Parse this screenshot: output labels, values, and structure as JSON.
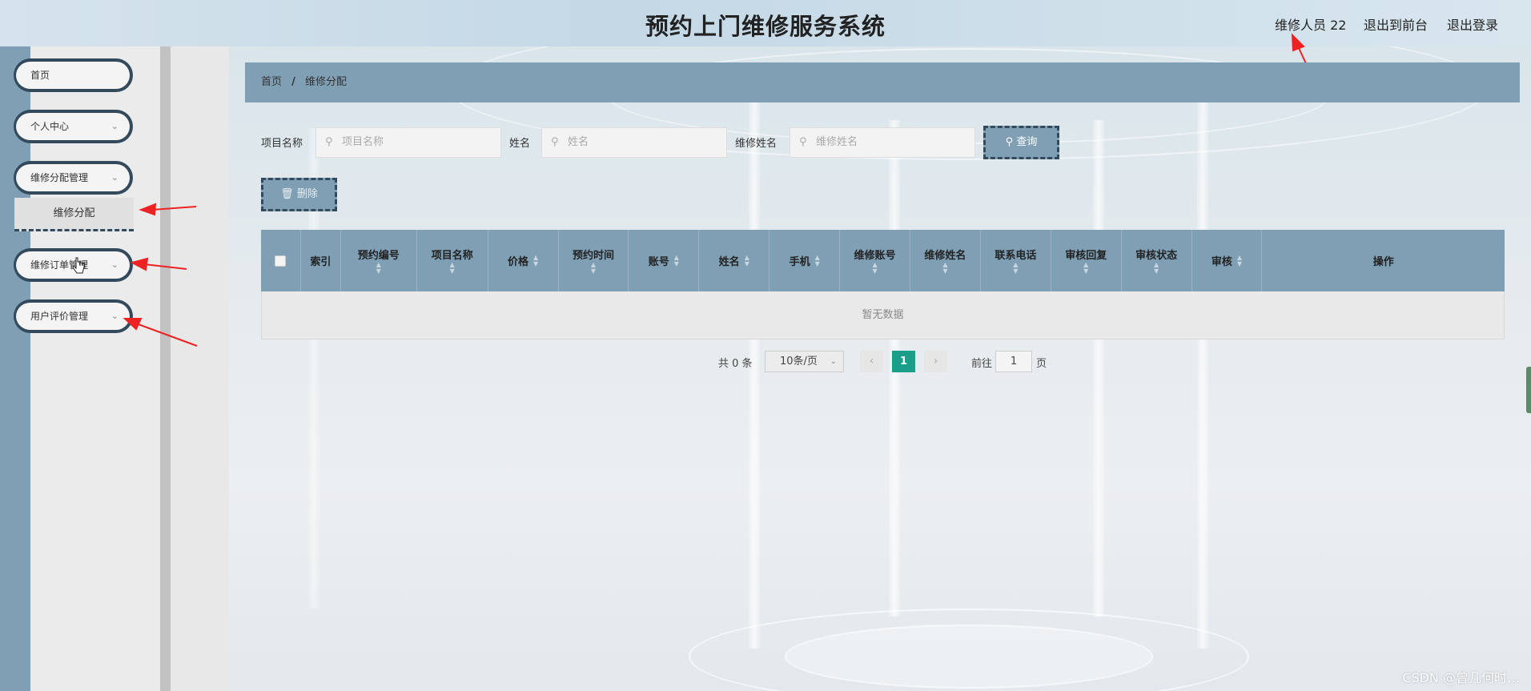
{
  "header": {
    "title": "预约上门维修服务系统",
    "user_label": "维修人员 22",
    "front_link": "退出到前台",
    "logout_link": "退出登录"
  },
  "sidebar": {
    "items": [
      {
        "label": "首页"
      },
      {
        "label": "个人中心"
      },
      {
        "label": "维修分配管理"
      },
      {
        "label": "维修订单管理"
      },
      {
        "label": "用户评价管理"
      }
    ],
    "active_sub": "维修分配"
  },
  "breadcrumb": {
    "home": "首页",
    "separator": "/",
    "current": "维修分配"
  },
  "search": {
    "project_label": "项目名称",
    "project_placeholder": "项目名称",
    "name_label": "姓名",
    "name_placeholder": "姓名",
    "repair_label": "维修姓名",
    "repair_placeholder": "维修姓名",
    "query_button": "查询"
  },
  "actions": {
    "delete_button": "删除"
  },
  "table": {
    "columns": [
      "索引",
      "预约编号",
      "项目名称",
      "价格",
      "预约时间",
      "账号",
      "姓名",
      "手机",
      "维修账号",
      "维修姓名",
      "联系电话",
      "审核回复",
      "审核状态",
      "审核",
      "操作"
    ],
    "empty_text": "暂无数据"
  },
  "pagination": {
    "total_text": "共 0 条",
    "page_size": "10条/页",
    "current_page": "1",
    "goto_label": "前往",
    "goto_value": "1",
    "page_suffix": "页"
  },
  "watermark": "CSDN @曾几何时…",
  "colors": {
    "accent": "#7f9fb4",
    "dark_border": "#33495c",
    "page_active": "#1a9e8a",
    "arrow": "#ee2222"
  }
}
